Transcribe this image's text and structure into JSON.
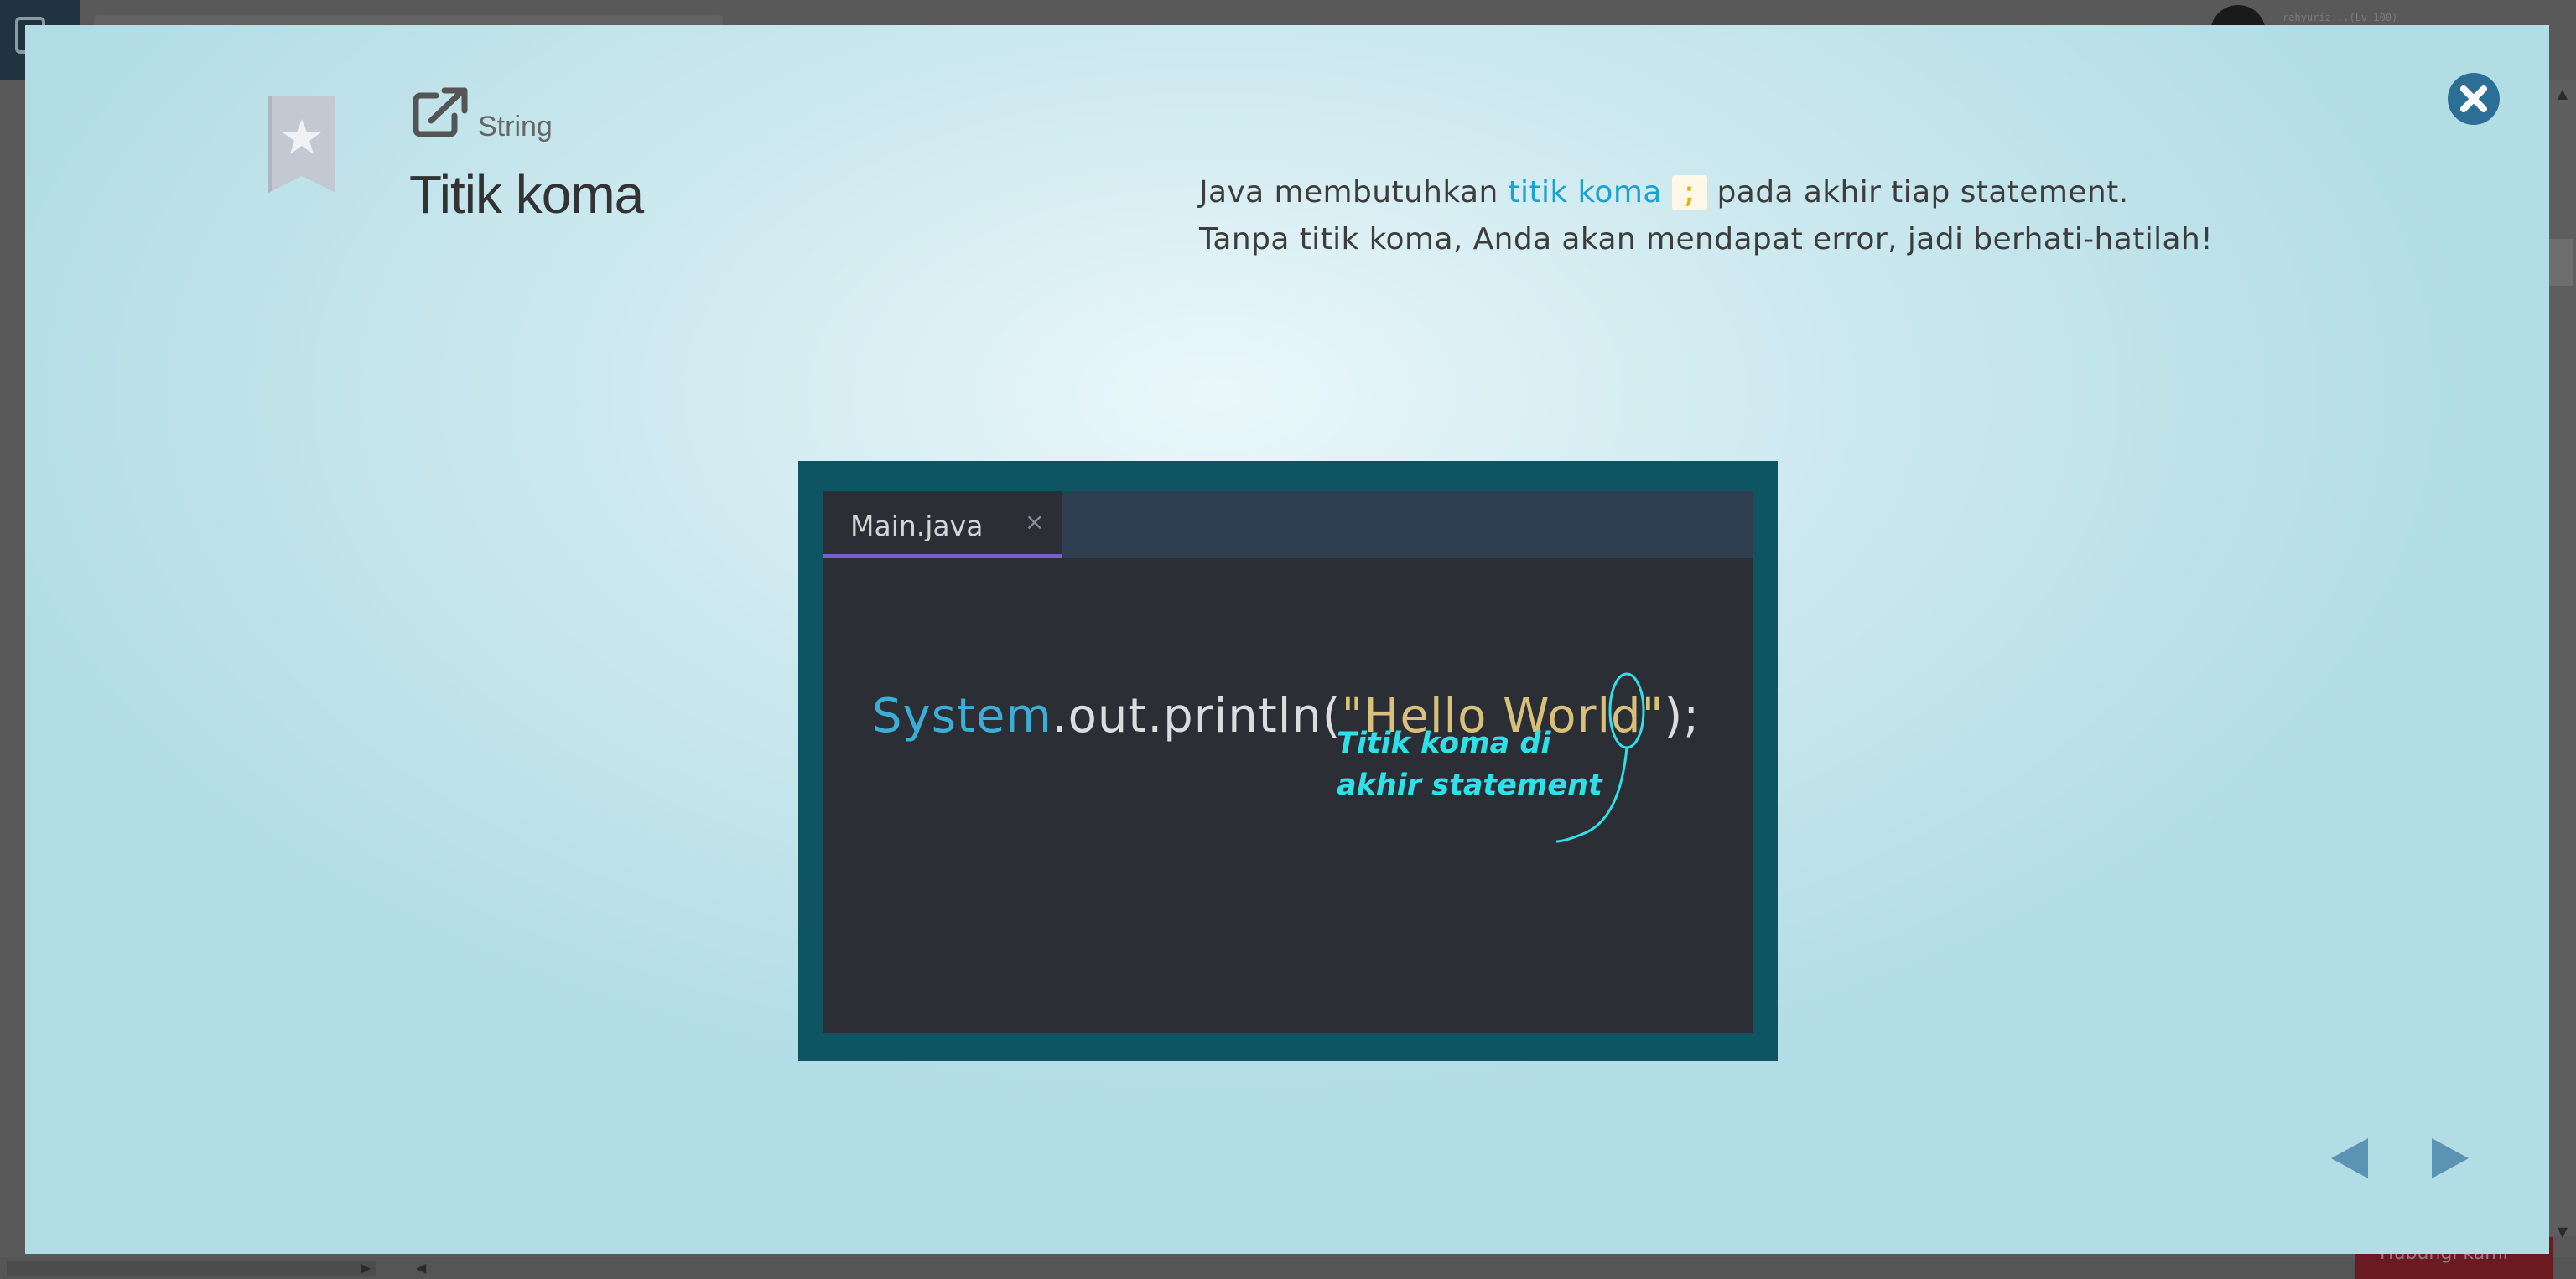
{
  "background_app": {
    "username": "rahyuriz...(Lv 100)",
    "help_button": "Hubungi kami"
  },
  "lesson": {
    "category": "String",
    "title": "Titik koma"
  },
  "description": {
    "line1_before": "Java membutuhkan ",
    "line1_highlight": "titik koma",
    "line1_code": ";",
    "line1_after": " pada akhir tiap statement.",
    "line2": "Tanpa titik koma, Anda akan mendapat error, jadi berhati-hatilah!"
  },
  "editor": {
    "tab_label": "Main.java",
    "tab_close": "×",
    "code_class": "System",
    "code_middle": ".out.println(",
    "code_string": "\"Hello World\"",
    "code_close": ")",
    "code_semicolon": ";",
    "annotation": "Titik koma di\nakhir statement"
  },
  "colors": {
    "accent_blue": "#1aa3cf",
    "close_button": "#2b6e96",
    "nav_arrows": "#5b93b5",
    "editor_frame": "#0e5462"
  },
  "icons": {
    "bookmark": "bookmark-star-icon",
    "share": "external-link-icon",
    "close": "close-circle-icon",
    "prev": "triangle-left-icon",
    "next": "triangle-right-icon"
  }
}
